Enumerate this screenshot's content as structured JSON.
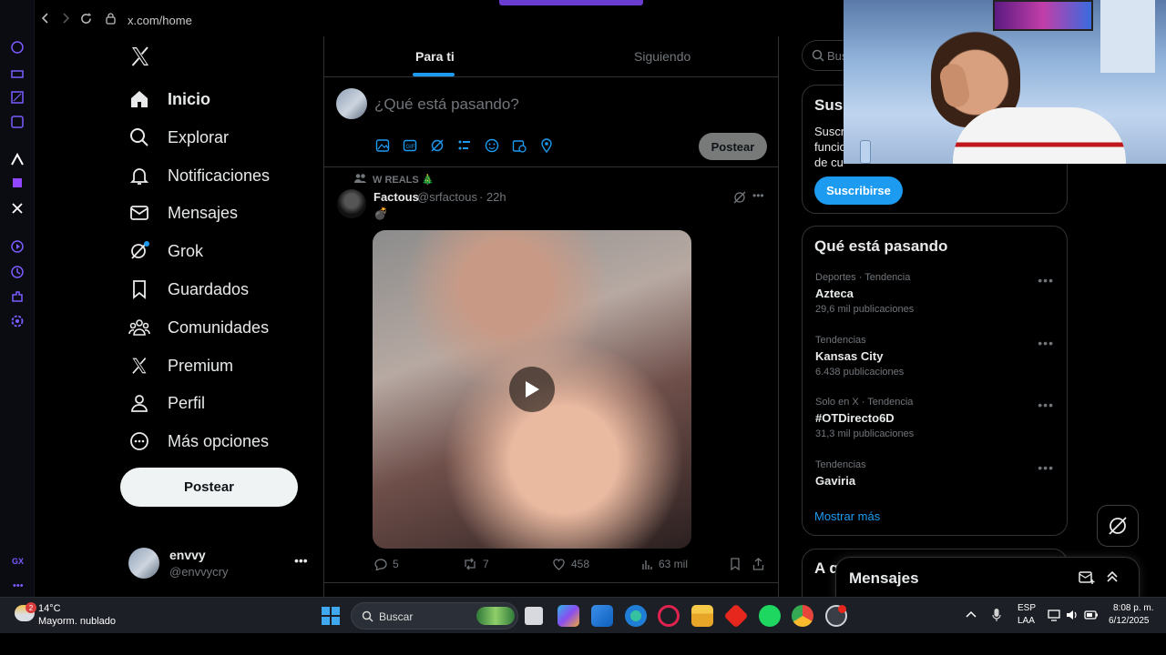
{
  "browser": {
    "url": "x.com/home",
    "side_label": "GX"
  },
  "nav": {
    "items": [
      {
        "label": "Inicio",
        "icon": "home-icon"
      },
      {
        "label": "Explorar",
        "icon": "search-icon"
      },
      {
        "label": "Notificaciones",
        "icon": "bell-icon"
      },
      {
        "label": "Mensajes",
        "icon": "mail-icon"
      },
      {
        "label": "Grok",
        "icon": "grok-icon"
      },
      {
        "label": "Guardados",
        "icon": "bookmark-icon"
      },
      {
        "label": "Comunidades",
        "icon": "communities-icon"
      },
      {
        "label": "Premium",
        "icon": "x-logo-icon"
      },
      {
        "label": "Perfil",
        "icon": "person-icon"
      },
      {
        "label": "Más opciones",
        "icon": "more-circle-icon"
      }
    ],
    "post_button": "Postear",
    "account": {
      "name": "envvy",
      "handle": "@envvycry"
    }
  },
  "feed": {
    "tabs": [
      "Para ti",
      "Siguiendo"
    ],
    "compose_placeholder": "¿Qué está pasando?",
    "compose_post": "Postear",
    "post": {
      "community": "W REALS 🎄",
      "author": "Factous",
      "handle": "@srfactous",
      "time": "· 22h",
      "text": "💣",
      "replies": "5",
      "reposts": "7",
      "likes": "458",
      "views": "63 mil"
    }
  },
  "sidebar": {
    "search_placeholder": "Bus",
    "premium": {
      "title": "Sus",
      "line1": "Suscr",
      "line2": "funcio",
      "line3": "de cu",
      "button": "Suscribirse"
    },
    "trends_title": "Qué está pasando",
    "trends": [
      {
        "category": "Deportes · Tendencia",
        "name": "Azteca",
        "count": "29,6 mil publicaciones"
      },
      {
        "category": "Tendencias",
        "name": "Kansas City",
        "count": "6.438 publicaciones"
      },
      {
        "category": "Solo en X · Tendencia",
        "name": "#OTDirecto6D",
        "count": "31,3 mil publicaciones"
      },
      {
        "category": "Tendencias",
        "name": "Gaviria",
        "count": ""
      }
    ],
    "show_more": "Mostrar más",
    "follow_title": "A q",
    "messages_title": "Mensajes"
  },
  "taskbar": {
    "weather_temp": "14°C",
    "weather_desc": "Mayorm. nublado",
    "weather_badge": "2",
    "search_placeholder": "Buscar",
    "lang1": "ESP",
    "lang2": "LAA",
    "time": "8:08 p. m.",
    "date": "6/12/2025"
  },
  "colors": {
    "accent": "#1d9bf0",
    "background": "#000000",
    "border": "#2f3336",
    "muted": "#71767b",
    "opera": "#6a3ccf"
  }
}
